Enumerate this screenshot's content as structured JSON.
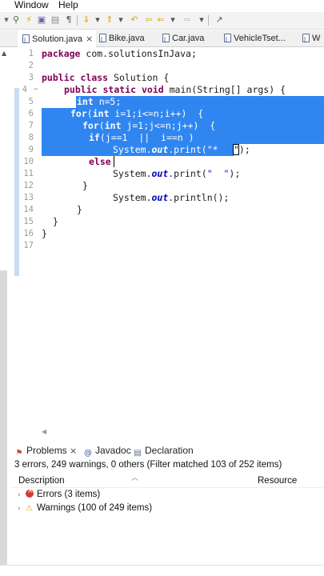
{
  "menu": {
    "window": "Window",
    "help": "Help"
  },
  "tabs": [
    {
      "label": "Solution.java",
      "close": "×"
    },
    {
      "label": "Bike.java"
    },
    {
      "label": "Car.java"
    },
    {
      "label": "VehicleTset..."
    },
    {
      "label": "W"
    }
  ],
  "editor": {
    "lines": [
      "1",
      "2",
      "3",
      "4",
      "5",
      "6",
      "7",
      "8",
      "9",
      "10",
      "11",
      "12",
      "13",
      "14",
      "15",
      "16",
      "17"
    ],
    "fold_marker": "−",
    "code": {
      "l1_kw": "package",
      "l1_rest": " com.solutionsInJava;",
      "l3_kw1": "public",
      "l3_kw2": "class",
      "l3_rest": " Solution {",
      "l4_kw1": "public",
      "l4_kw2": "static",
      "l4_kw3": "void",
      "l4_rest": " main(String[] args) {",
      "l5_kw": "int",
      "l5_rest": " n=5;",
      "l6_kw1": "for",
      "l6_p1": "(",
      "l6_kw2": "int",
      "l6_rest": " i=1;i<=n;i++)  {",
      "l7_kw1": "for",
      "l7_p1": "(",
      "l7_kw2": "int",
      "l7_rest": " j=1;j<=n;j++)  {",
      "l8_kw": "if",
      "l8_rest": "(j==1  ||  i==n )",
      "l9_a": "System.",
      "l9_fld": "out",
      "l9_b": ".print(",
      "l9_str": "\"* ",
      "l9_end": "\");",
      "l10_kw": "else",
      "l11_a": "System.",
      "l11_fld": "out",
      "l11_b": ".print(",
      "l11_str": "\"  \"",
      "l11_end": ");",
      "l12": "}",
      "l13_a": "System.",
      "l13_fld": "out",
      "l13_b": ".println();",
      "l14": "}",
      "l15": "}",
      "l16": "}"
    }
  },
  "panel": {
    "tabs": [
      {
        "label": "Problems",
        "close": "×"
      },
      {
        "label": "Javadoc"
      },
      {
        "label": "Declaration"
      }
    ],
    "summary": "3 errors, 249 warnings, 0 others (Filter matched 103 of 252 items)",
    "columns": {
      "description": "Description",
      "resource": "Resource"
    },
    "rows": [
      {
        "label": "Errors (3 items)"
      },
      {
        "label": "Warnings (100 of 249 items)"
      }
    ]
  },
  "colors": {
    "selection": "#2f86f0",
    "keyword": "#7f0055",
    "field": "#0000c0",
    "string": "#2a00ff"
  }
}
